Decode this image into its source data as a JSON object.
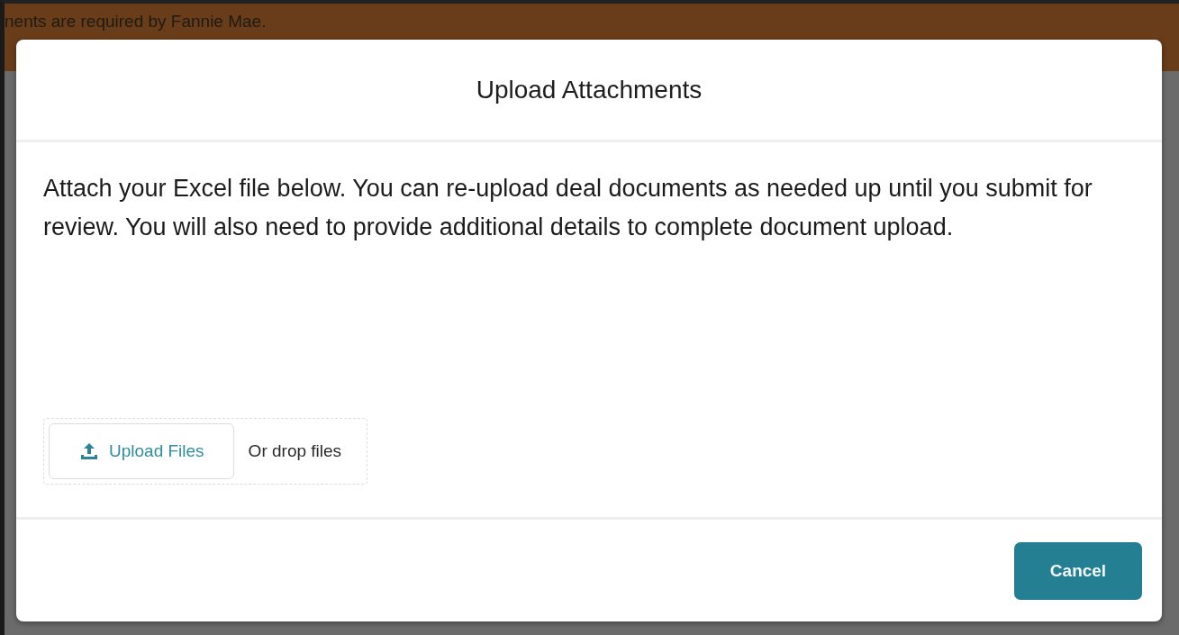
{
  "background": {
    "banner_text": "nents are required by Fannie Mae."
  },
  "modal": {
    "title": "Upload Attachments",
    "message": "Attach your Excel file below. You can re-upload deal documents as needed up until you submit for review. You will also need to provide additional details to complete document upload.",
    "upload_button": "Upload Files",
    "drop_hint": "Or drop files",
    "buttons": [
      "Cancel"
    ]
  }
}
